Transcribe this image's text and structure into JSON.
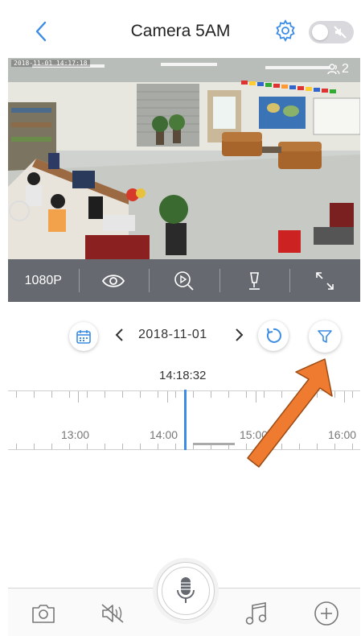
{
  "header": {
    "title": "Camera 5AM"
  },
  "video": {
    "osd_timestamp": "2018-11-01 14:17:18",
    "viewer_count": "2"
  },
  "controls": {
    "resolution": "1080P"
  },
  "playback": {
    "date": "2018-11-01",
    "current_time": "14:18:32"
  },
  "timeline": {
    "labels": [
      "13:00",
      "14:00",
      "15:00",
      "16:00"
    ]
  },
  "colors": {
    "accent": "#3b8ce4",
    "control_bar": "#666a70",
    "arrow": "#ee7b2f"
  },
  "icons": {
    "back": "back-chevron-icon",
    "settings": "gear-icon",
    "privacy_toggle": "mute-toggle",
    "view": "eye-icon",
    "playback": "playback-search-icon",
    "ptz": "ptz-icon",
    "fullscreen": "fullscreen-icon",
    "calendar": "calendar-icon",
    "refresh": "refresh-icon",
    "filter": "filter-icon",
    "snapshot": "camera-icon",
    "sound": "speaker-muted-icon",
    "talk": "microphone-icon",
    "music": "music-icon",
    "add": "plus-icon"
  }
}
